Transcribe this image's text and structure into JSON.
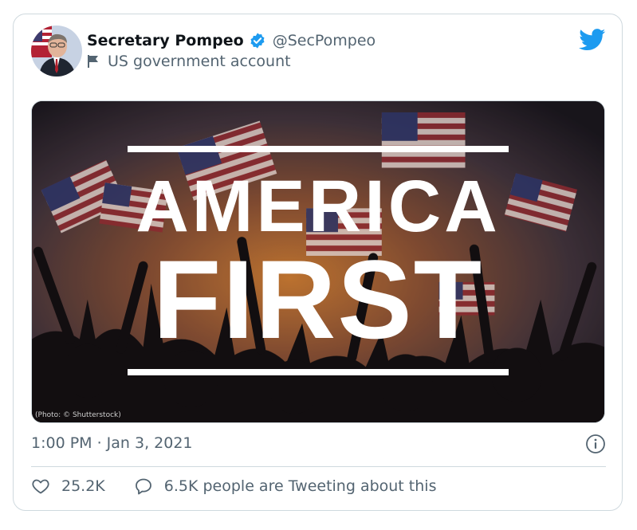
{
  "tweet": {
    "author": {
      "display_name": "Secretary Pompeo",
      "handle": "@SecPompeo",
      "account_label": "US government account"
    },
    "media": {
      "headline_line1": "AMERICA",
      "headline_line2": "FIRST",
      "photo_credit": "(Photo: © Shutterstock)"
    },
    "timestamp": "1:00 PM · Jan 3, 2021",
    "likes": "25.2K",
    "engagement_text": "6.5K people are Tweeting about this"
  },
  "icons": {
    "verified": "verified-badge-icon",
    "label": "flag-icon",
    "brand": "twitter-bird-icon",
    "info": "info-icon",
    "like": "heart-icon",
    "reply": "speech-bubble-icon"
  },
  "colors": {
    "brand": "#1d9bf0",
    "secondary_text": "#536471",
    "border": "#cfd9de"
  }
}
